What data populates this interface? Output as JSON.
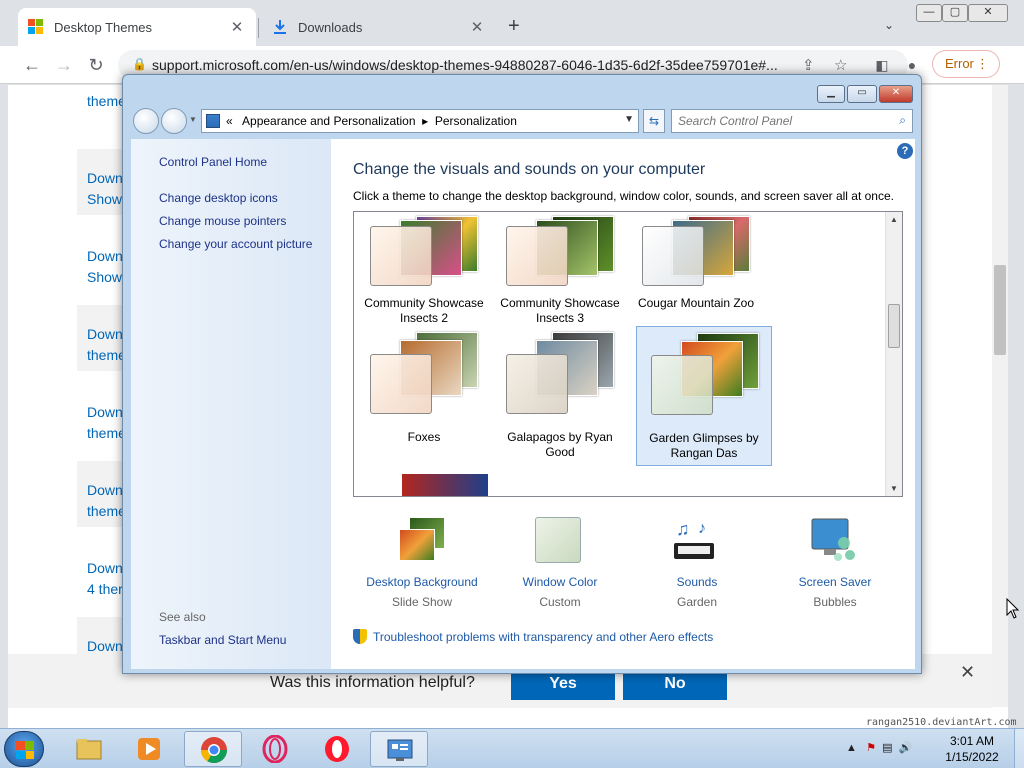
{
  "browser": {
    "tabs": [
      {
        "title": "Desktop Themes",
        "active": true,
        "icon": "microsoft-logo-icon"
      },
      {
        "title": "Downloads",
        "active": false,
        "icon": "download-icon"
      }
    ],
    "url": "support.microsoft.com/en-us/windows/desktop-themes-94880287-6046-1d35-6d2f-35dee759701e#...",
    "error_label": "Error",
    "page_links": [
      "theme",
      "Down",
      "Show",
      "Down",
      "Show",
      "Down",
      "theme",
      "Down",
      "theme",
      "Down",
      "theme",
      "Down",
      "4 ther",
      "Down"
    ]
  },
  "feedback": {
    "question": "Was this information helpful?",
    "yes": "Yes",
    "no": "No"
  },
  "watermark": "rangan2510.deviantArt.com",
  "control_panel": {
    "breadcrumb_prefix": "«",
    "breadcrumb": [
      "Appearance and Personalization",
      "Personalization"
    ],
    "search_placeholder": "Search Control Panel",
    "left": {
      "home": "Control Panel Home",
      "links": [
        "Change desktop icons",
        "Change mouse pointers",
        "Change your account picture"
      ],
      "see_also": "See also",
      "see_also_links": [
        "Taskbar and Start Menu"
      ]
    },
    "heading": "Change the visuals and sounds on your computer",
    "subheading": "Click a theme to change the desktop background, window color, sounds, and screen saver all at once.",
    "themes": [
      {
        "name": "Community Showcase Insects 2",
        "selected": false
      },
      {
        "name": "Community Showcase Insects 3",
        "selected": false
      },
      {
        "name": "Cougar Mountain Zoo",
        "selected": false
      },
      {
        "name": "Foxes",
        "selected": false
      },
      {
        "name": "Galapagos by Ryan Good",
        "selected": false
      },
      {
        "name": "Garden Glimpses by Rangan Das",
        "selected": true
      }
    ],
    "options": [
      {
        "label": "Desktop Background",
        "value": "Slide Show",
        "icon": "desktop-background-icon"
      },
      {
        "label": "Window Color",
        "value": "Custom",
        "icon": "window-color-icon"
      },
      {
        "label": "Sounds",
        "value": "Garden",
        "icon": "sounds-icon"
      },
      {
        "label": "Screen Saver",
        "value": "Bubbles",
        "icon": "screen-saver-icon"
      }
    ],
    "troubleshoot": "Troubleshoot problems with transparency and other Aero effects"
  },
  "taskbar": {
    "apps": [
      "explorer",
      "media-player",
      "chrome",
      "opera-gx",
      "opera",
      "control-panel"
    ],
    "time": "3:01 AM",
    "date": "1/15/2022"
  }
}
